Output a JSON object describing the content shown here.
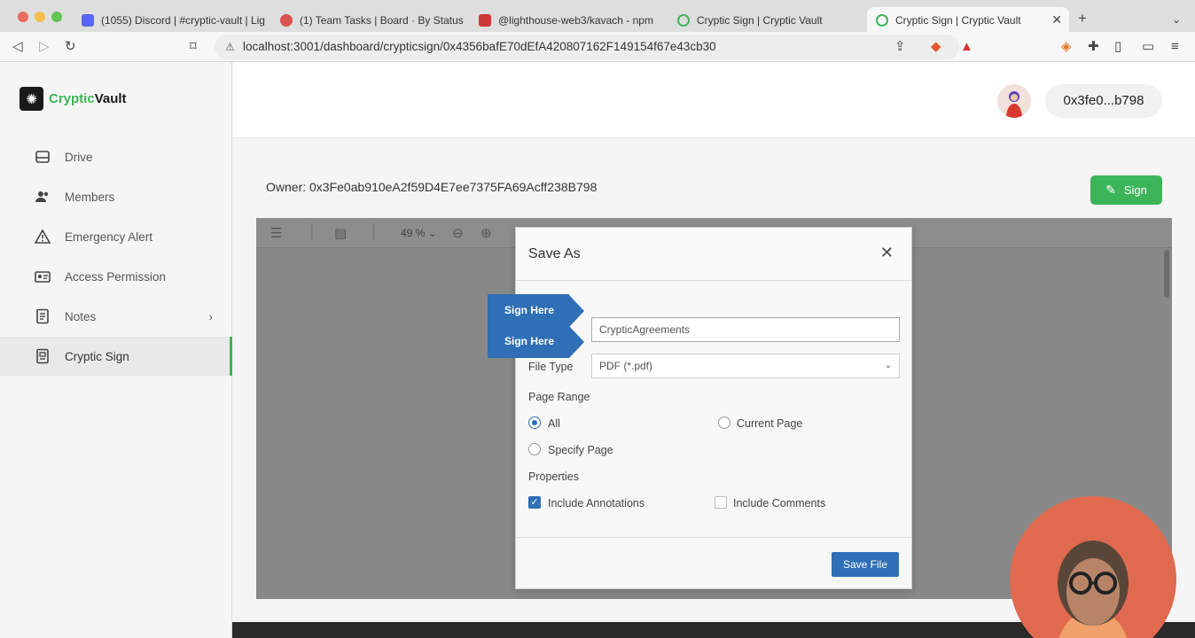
{
  "browser": {
    "tabs": [
      {
        "title": "(1055) Discord | #cryptic-vault | Lig"
      },
      {
        "title": "(1) Team Tasks | Board · By Status"
      },
      {
        "title": "@lighthouse-web3/kavach - npm"
      },
      {
        "title": "Cryptic Sign | Cryptic Vault"
      },
      {
        "title": "Cryptic Sign | Cryptic Vault"
      }
    ],
    "url": "localhost:3001/dashboard/crypticsign/0x4356bafE70dEfA420807162F149154f67e43cb30"
  },
  "sidebar": {
    "logo_part1": "Cryptic",
    "logo_part2": "Vault",
    "items": [
      {
        "label": "Drive",
        "icon": "drive-icon"
      },
      {
        "label": "Members",
        "icon": "members-icon"
      },
      {
        "label": "Emergency Alert",
        "icon": "alert-icon"
      },
      {
        "label": "Access Permission",
        "icon": "access-icon"
      },
      {
        "label": "Notes",
        "icon": "notes-icon"
      },
      {
        "label": "Cryptic Sign",
        "icon": "sign-icon"
      }
    ]
  },
  "header": {
    "wallet": "0x3fe0...b798"
  },
  "main": {
    "owner": "Owner: 0x3Fe0ab910eA2f59D4E7ee7375FA69Acff238B798",
    "sign_label": "Sign"
  },
  "viewer": {
    "zoom": "49 %"
  },
  "dialog": {
    "title": "Save As",
    "filename": "CrypticAgreements",
    "file_type_label": "File Type",
    "file_type_value": "PDF (*.pdf)",
    "page_range_label": "Page Range",
    "opt_all": "All",
    "opt_current": "Current Page",
    "opt_specify": "Specify Page",
    "properties_label": "Properties",
    "opt_annotations": "Include Annotations",
    "opt_comments": "Include Comments",
    "save_label": "Save File"
  },
  "sign_tags": [
    "Sign Here",
    "Sign Here"
  ],
  "colors": {
    "accent": "#3cb55a",
    "dialog_primary": "#2e6fb6"
  }
}
